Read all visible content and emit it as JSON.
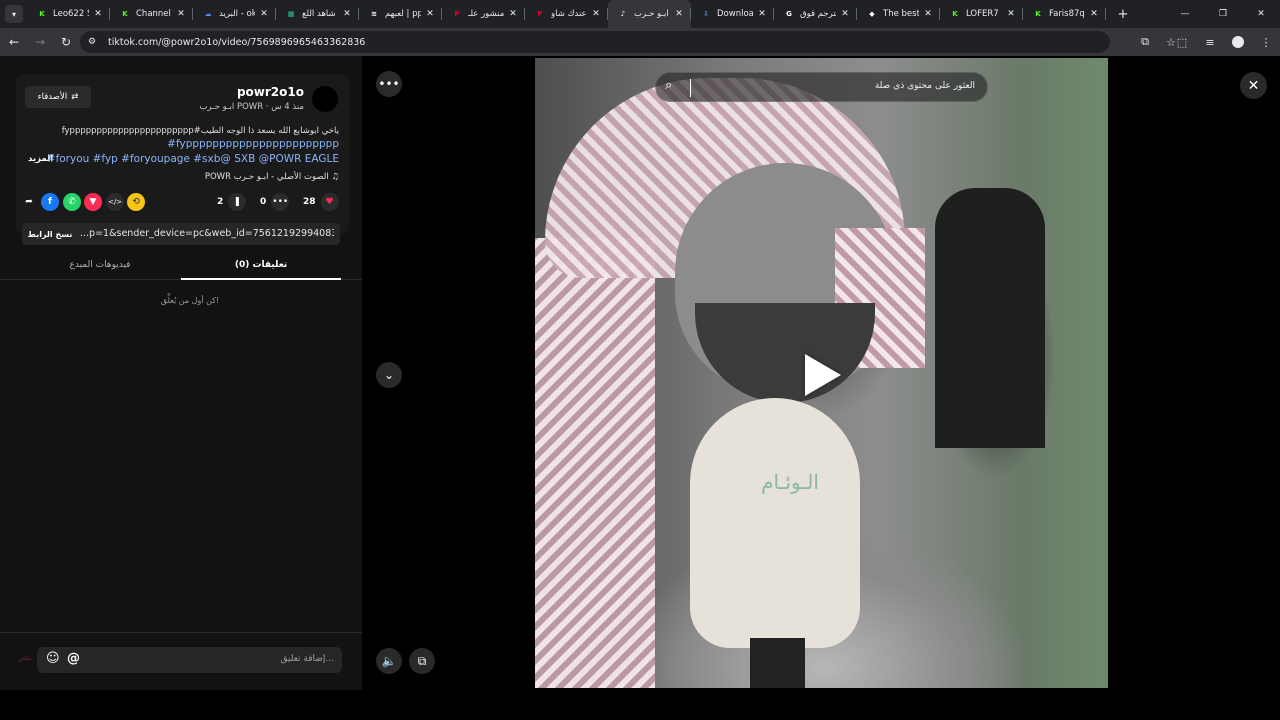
{
  "browser": {
    "tabs": [
      {
        "title": "Leo622 St",
        "fav": "K",
        "fav_color": "#53fc18",
        "active": false
      },
      {
        "title": "Channel P",
        "fav": "K",
        "fav_color": "#53fc18",
        "active": false
      },
      {
        "title": "البريد - ok",
        "fav": "☁",
        "fav_color": "#4c8bf5",
        "active": false
      },
      {
        "title": "شاهد اللع",
        "fav": "▦",
        "fav_color": "#2ec4a6",
        "active": false
      },
      {
        "title": "لعبهم | pp",
        "fav": "≋",
        "fav_color": "#ffffff",
        "active": false
      },
      {
        "title": "منشور علـ",
        "fav": "P",
        "fav_color": "#e60023",
        "active": false
      },
      {
        "title": "عندك شاو",
        "fav": "P",
        "fav_color": "#e60023",
        "active": false
      },
      {
        "title": "ابـو حـرب",
        "fav": "♪",
        "fav_color": "#ffffff",
        "active": true
      },
      {
        "title": "Download",
        "fav": "⇩",
        "fav_color": "#4c8bf5",
        "active": false
      },
      {
        "title": "مترجم قوق",
        "fav": "G",
        "fav_color": "#ffffff",
        "active": false
      },
      {
        "title": "The best C",
        "fav": "◆",
        "fav_color": "#ffffff",
        "active": false
      },
      {
        "title": "LOFER7 St",
        "fav": "K",
        "fav_color": "#53fc18",
        "active": false
      },
      {
        "title": "Faris87q S",
        "fav": "K",
        "fav_color": "#53fc18",
        "active": false
      }
    ],
    "new_tab": "+",
    "url": "tiktok.com/@powr2o1o/video/7569896965463362836"
  },
  "author": {
    "username": "powr2o1o",
    "subline": "ابـو حـرب POWR · منذ 4 س",
    "follow_label": "الأصدقاء"
  },
  "caption": {
    "line1": "ياخي ابوشايع الله يسعد ذا الوجه الطيب#fyppppppppppppppppppppppp",
    "line2": "#foryou #fyp #foryoupage #sxb@ SXB @POWR EAGLE",
    "more": "المزيد",
    "music": "الصوت الأصلي - ابـو حـرب POWR"
  },
  "stats": {
    "likes": "28",
    "comments": "0",
    "saves": "2"
  },
  "share": {
    "url": "...p=1&sender_device=pc&web_id=7561219299408332300",
    "copy_label": "نسخ الرابط"
  },
  "tabs": {
    "comments": "(0) تعليقات",
    "creator_videos": "فيديوهات المبدع"
  },
  "empty_message": "كن أول من يُعلِّق!",
  "comment_box": {
    "placeholder": "إضافة تعليق...",
    "post_label": "نشر"
  },
  "video": {
    "search_placeholder": "العثور على محتوى ذي صلة",
    "mic_logo": "الـوئـام"
  },
  "colors": {
    "accent": "#fe2c55",
    "link": "#8ab4f8",
    "kick_green": "#53fc18"
  }
}
